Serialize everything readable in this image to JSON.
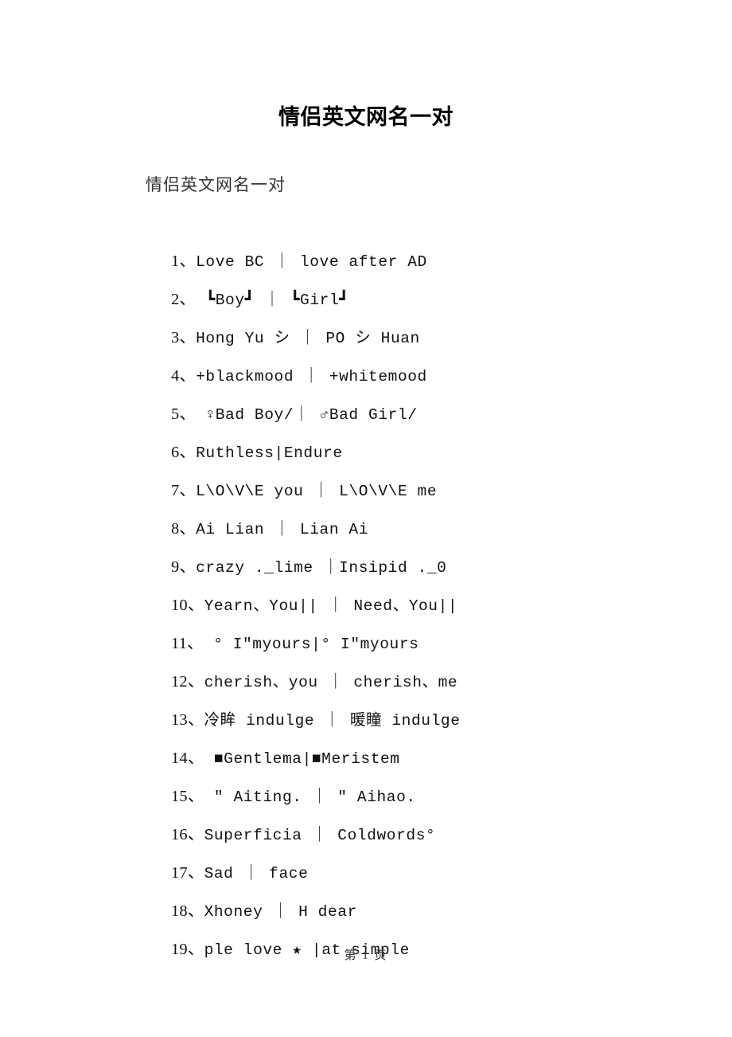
{
  "document": {
    "title": "情侣英文网名一对",
    "lead": "情侣英文网名一对",
    "footer": "第 1 页"
  },
  "items": [
    {
      "num": "1、",
      "text": "Love BC ｜ love after AD"
    },
    {
      "num": "2、",
      "text": " ┗Boy┛ ｜ ┗Girl┛"
    },
    {
      "num": "3、",
      "text": "Hong Yu シ ｜ PO シ Huan"
    },
    {
      "num": "4、",
      "text": "+blackmood ｜ +whitemood"
    },
    {
      "num": "5、",
      "text": " ♀Bad Boy/｜ ♂Bad Girl/"
    },
    {
      "num": "6、",
      "text": "Ruthless|Endure"
    },
    {
      "num": "7、",
      "text": "L\\O\\V\\E you ｜ L\\O\\V\\E me"
    },
    {
      "num": "8、",
      "text": "Ai Lian ｜ Lian Ai"
    },
    {
      "num": "9、",
      "text": "crazy ._lime ｜Insipid ._0"
    },
    {
      "num": "10、",
      "text": "Yearn、You|| ｜ Need、You||"
    },
    {
      "num": "11、",
      "text": " ° I″myours|° I″myours"
    },
    {
      "num": "12、",
      "text": "cherish、you ｜ cherish、me"
    },
    {
      "num": "13、",
      "text": "冷眸 indulge ｜ 暖瞳 indulge"
    },
    {
      "num": "14、",
      "text": " ■Gentlema|■Meristem"
    },
    {
      "num": "15、",
      "text": " ″ Aiting. ｜ ″ Aihao."
    },
    {
      "num": "16、",
      "text": "Superficia ｜ Coldwords°"
    },
    {
      "num": "17、",
      "text": "Sad ｜ face"
    },
    {
      "num": "18、",
      "text": "Xhoney ｜ H dear"
    },
    {
      "num": "19、",
      "text": "ple love ★ |at simple"
    }
  ],
  "colors": {
    "background": "#ffffff",
    "text": "#111111",
    "separator": "#777777"
  }
}
